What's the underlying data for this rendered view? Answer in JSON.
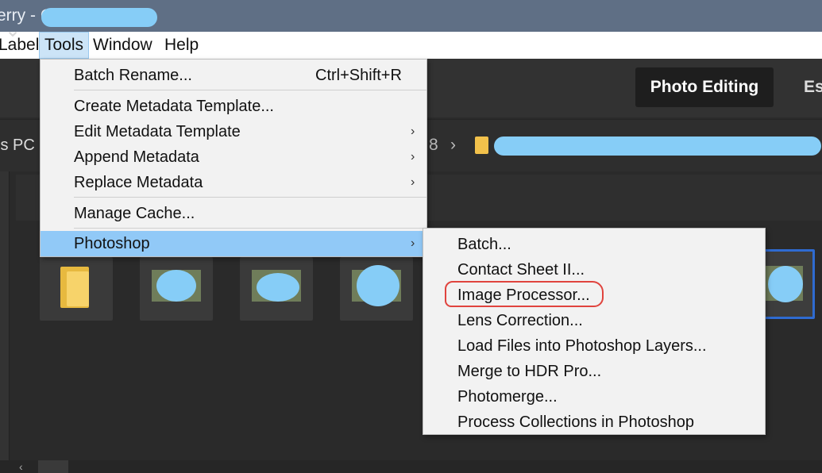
{
  "titlebar": {
    "title": "erry - C"
  },
  "menubar": {
    "items": [
      {
        "label": "Label"
      },
      {
        "label": "Tools"
      },
      {
        "label": "Window"
      },
      {
        "label": "Help"
      }
    ]
  },
  "toolbar": {
    "workspace_active": "Photo Editing",
    "workspace_next": "Es"
  },
  "path": {
    "left": "is PC",
    "segment_num": "8",
    "separator": "›"
  },
  "tools_menu": {
    "items": [
      {
        "label": "Batch Rename...",
        "shortcut": "Ctrl+Shift+R"
      },
      {
        "label": "Create Metadata Template..."
      },
      {
        "label": "Edit Metadata Template",
        "arrow": "›"
      },
      {
        "label": "Append Metadata",
        "arrow": "›"
      },
      {
        "label": "Replace Metadata",
        "arrow": "›"
      },
      {
        "label": "Manage Cache..."
      },
      {
        "label": "Photoshop",
        "arrow": "›"
      }
    ]
  },
  "photoshop_submenu": {
    "items": [
      {
        "label": "Batch..."
      },
      {
        "label": "Contact Sheet II..."
      },
      {
        "label": "Image Processor..."
      },
      {
        "label": "Lens Correction..."
      },
      {
        "label": "Load Files into Photoshop Layers..."
      },
      {
        "label": "Merge to HDR Pro..."
      },
      {
        "label": "Photomerge..."
      },
      {
        "label": "Process Collections in Photoshop"
      }
    ]
  },
  "scrollbar": {
    "left_arrow": "‹"
  },
  "colors": {
    "menu_highlight": "#91c9f7",
    "selection_border": "#2f6bd1",
    "annotation_red": "#e0443e",
    "redaction_blue": "#86cdf7"
  }
}
